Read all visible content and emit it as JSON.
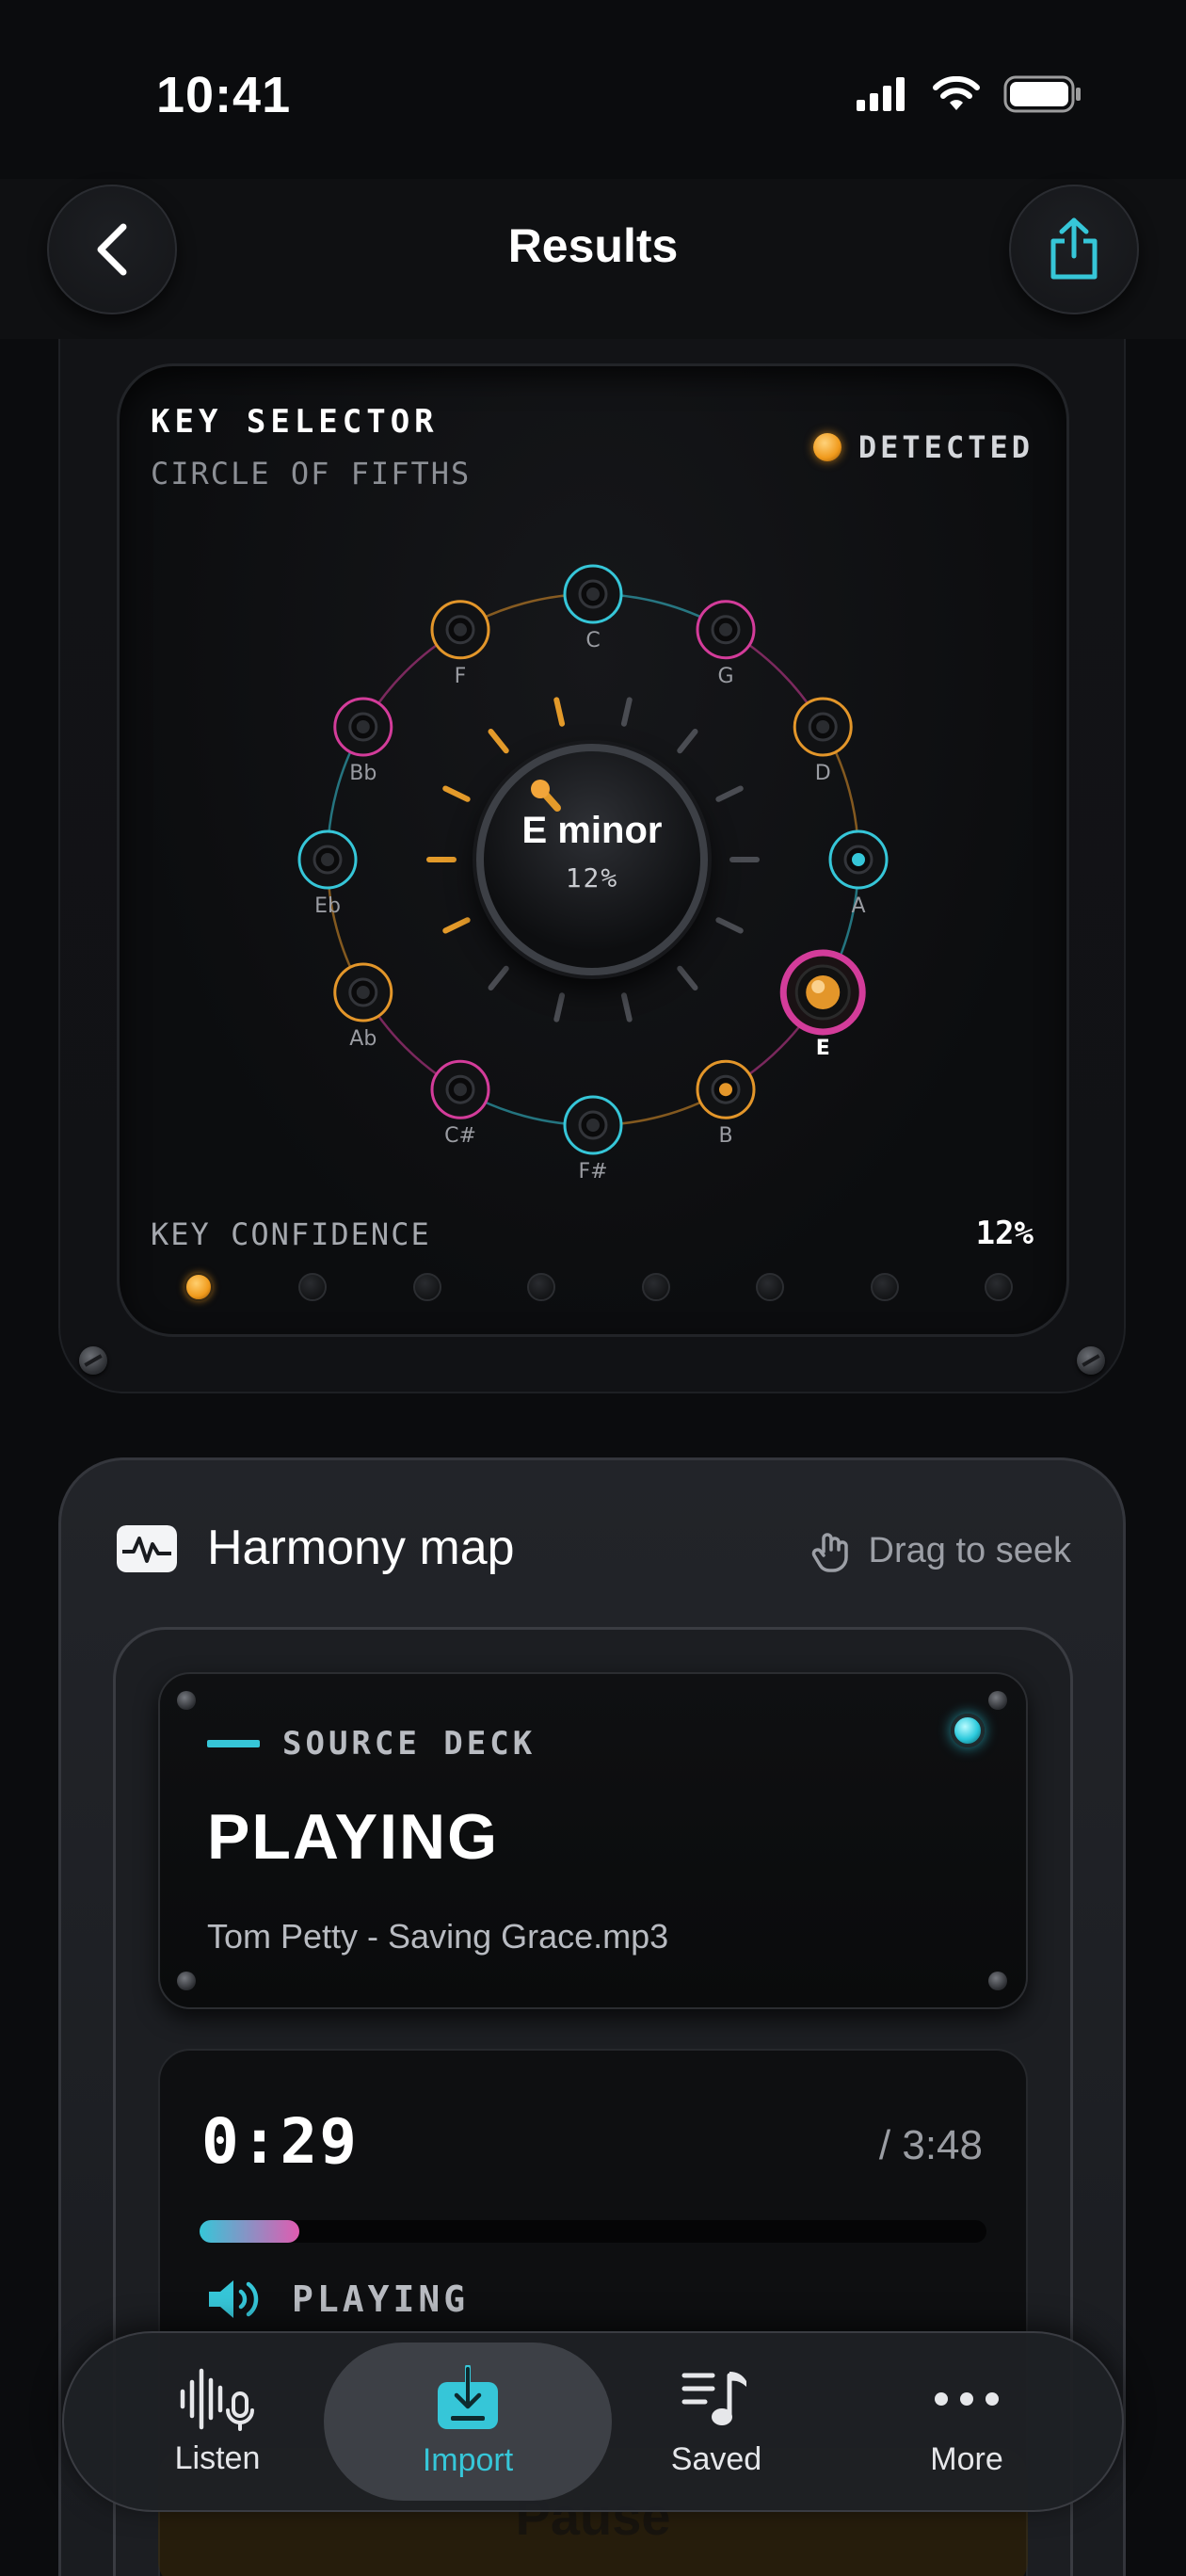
{
  "status_bar": {
    "time": "10:41"
  },
  "header": {
    "title": "Results"
  },
  "key_selector": {
    "title": "KEY SELECTOR",
    "subtitle": "CIRCLE OF FIFTHS",
    "detected_label": "DETECTED",
    "detected_key": "E minor",
    "detected_percent": "12%",
    "keys": [
      "C",
      "G",
      "D",
      "A",
      "E",
      "B",
      "F#",
      "C#",
      "Ab",
      "Eb",
      "Bb",
      "F"
    ],
    "selected_key": "E",
    "confidence_label": "KEY CONFIDENCE",
    "confidence_value": "12%",
    "confidence_level": 0.12,
    "colors": {
      "teal": "#36c6d8",
      "magenta": "#d33c9a",
      "orange": "#e3962a"
    }
  },
  "harmony_map": {
    "title": "Harmony map",
    "drag_hint": "Drag to seek",
    "source_deck": {
      "label": "SOURCE DECK",
      "state": "PLAYING",
      "file": "Tom Petty - Saving Grace.mp3"
    },
    "transport": {
      "elapsed": "0:29",
      "total": "/ 3:48",
      "progress": 0.127,
      "state": "PLAYING",
      "pause_label": "Pause"
    }
  },
  "tab_bar": {
    "tabs": [
      {
        "label": "Listen",
        "icon": "waveform-mic-icon"
      },
      {
        "label": "Import",
        "icon": "import-icon"
      },
      {
        "label": "Saved",
        "icon": "music-list-icon"
      },
      {
        "label": "More",
        "icon": "ellipsis-icon"
      }
    ],
    "active": "Import"
  }
}
